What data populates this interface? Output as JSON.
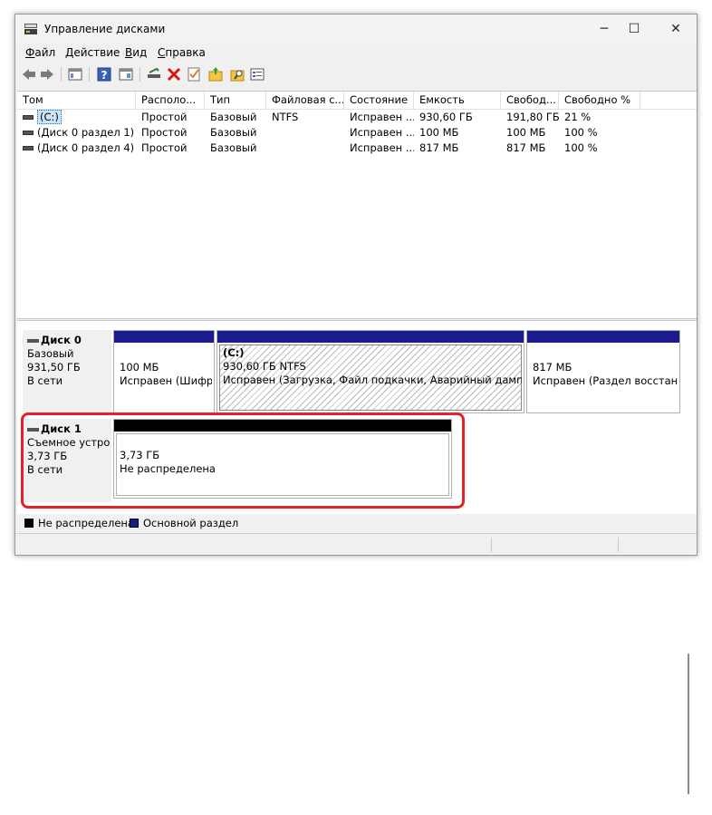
{
  "window": {
    "title": "Управление дисками",
    "icon": "disk-management-icon"
  },
  "menu": [
    {
      "label": "Файл",
      "mnemonic": "Ф",
      "rest": "айл"
    },
    {
      "label": "Действие",
      "mnemonic": "Д",
      "rest": "ействие"
    },
    {
      "label": "Вид",
      "mnemonic": "В",
      "rest": "ид"
    },
    {
      "label": "Справка",
      "mnemonic": "С",
      "rest": "правка"
    }
  ],
  "toolbar_icons": [
    "back-arrow-icon",
    "forward-arrow-icon",
    "show-hide-console-tree-icon",
    "help-icon",
    "properties-pane-icon",
    "connect-drive-icon",
    "delete-icon",
    "check-icon",
    "new-folder-icon",
    "search-folder-icon",
    "properties-icon"
  ],
  "columns": [
    "Том",
    "Располо...",
    "Тип",
    "Файловая с...",
    "Состояние",
    "Емкость",
    "Свобод...",
    "Свободно %"
  ],
  "volumes": [
    {
      "name": "(C:)",
      "layout": "Простой",
      "type": "Базовый",
      "fs": "NTFS",
      "status": "Исправен ...",
      "capacity": "930,60 ГБ",
      "free": "191,80 ГБ",
      "free_pct": "21 %",
      "selected": true
    },
    {
      "name": "(Диск 0 раздел 1)",
      "layout": "Простой",
      "type": "Базовый",
      "fs": "",
      "status": "Исправен ...",
      "capacity": "100 МБ",
      "free": "100 МБ",
      "free_pct": "100 %",
      "selected": false
    },
    {
      "name": "(Диск 0 раздел 4)",
      "layout": "Простой",
      "type": "Базовый",
      "fs": "",
      "status": "Исправен ...",
      "capacity": "817 МБ",
      "free": "817 МБ",
      "free_pct": "100 %",
      "selected": false
    }
  ],
  "disks": [
    {
      "name": "Диск 0",
      "kind": "Базовый",
      "size": "931,50 ГБ",
      "state": "В сети",
      "partitions": [
        {
          "label": "",
          "line1": "100 МБ",
          "line2": "Исправен (Шифро",
          "bar_color": "#1b1b8e"
        },
        {
          "label": "(C:)",
          "line1": "930,60 ГБ NTFS",
          "line2": "Исправен (Загрузка, Файл подкачки, Аварийный дамп пам.",
          "bar_color": "#1b1b8e"
        },
        {
          "label": "",
          "line1": "817 МБ",
          "line2": "Исправен (Раздел восстано",
          "bar_color": "#1b1b8e"
        }
      ]
    },
    {
      "name": "Диск 1",
      "kind": "Съемное устро",
      "size": "3,73 ГБ",
      "state": "В сети",
      "partitions": [
        {
          "label": "",
          "line1": "3,73 ГБ",
          "line2": "Не распределена",
          "bar_color": "#000000"
        }
      ]
    }
  ],
  "legend": [
    {
      "label": "Не распределена",
      "color": "#000000"
    },
    {
      "label": "Основной раздел",
      "color": "#1b1b8e"
    }
  ],
  "colors": {
    "primary_partition": "#1b1b8e",
    "unallocated": "#000000",
    "highlight": "#e3222a"
  }
}
